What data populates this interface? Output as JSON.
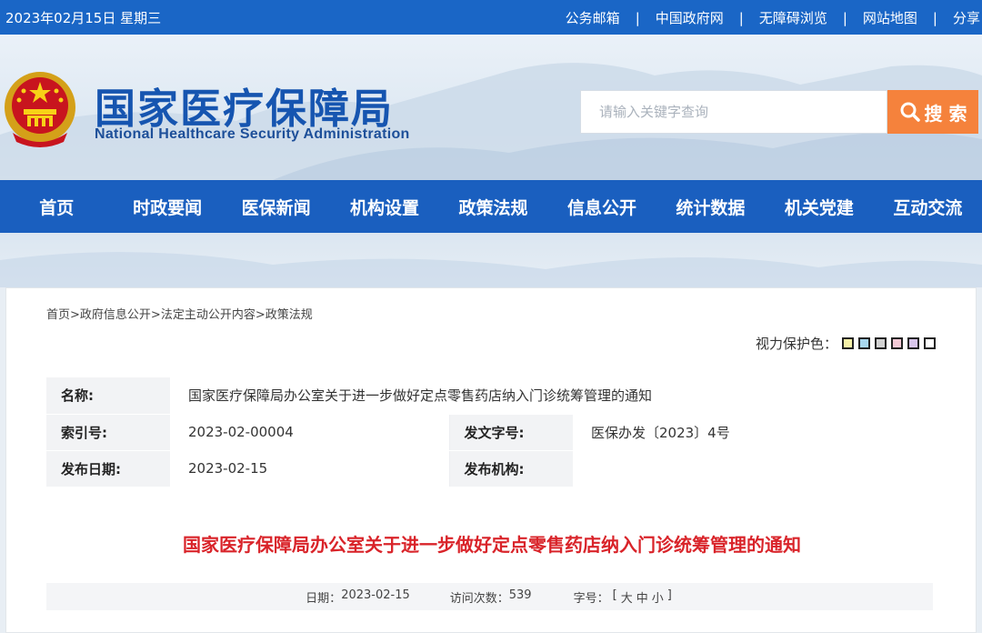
{
  "topbar": {
    "date": "2023年02月15日 星期三",
    "links": [
      "公务邮箱",
      "中国政府网",
      "无障碍浏览",
      "网站地图",
      "分享"
    ],
    "separator": "|"
  },
  "header": {
    "logo_cn": "国家医疗保障局",
    "logo_en": "National Healthcare Security Administration",
    "search_placeholder": "请输入关键字查询",
    "search_button": "搜 索"
  },
  "nav": [
    "首页",
    "时政要闻",
    "医保新闻",
    "机构设置",
    "政策法规",
    "信息公开",
    "统计数据",
    "机关党建",
    "互动交流"
  ],
  "breadcrumb": [
    "首页>",
    "政府信息公开>",
    "法定主动公开内容>",
    "政策法规"
  ],
  "vision": {
    "label": "视力保护色：",
    "colors": [
      "#f6f1a8",
      "#a8d8ef",
      "#d2d2d2",
      "#f3c9d6",
      "#d9c6ec",
      "#ffffff"
    ]
  },
  "meta": {
    "name_label": "名称:",
    "name_value": "国家医疗保障局办公室关于进一步做好定点零售药店纳入门诊统筹管理的通知",
    "index_label": "索引号:",
    "index_value": "2023-02-00004",
    "docno_label": "发文字号:",
    "docno_value": "医保办发〔2023〕4号",
    "date_label": "发布日期:",
    "date_value": "2023-02-15",
    "org_label": "发布机构:",
    "org_value": ""
  },
  "article": {
    "title": "国家医疗保障局办公室关于进一步做好定点零售药店纳入门诊统筹管理的通知",
    "date_label": "日期：",
    "date_value": "2023-02-15",
    "visits_label": "访问次数：",
    "visits_value": "539",
    "fontsize_label": "字号：",
    "fontsize_open": "[",
    "size_large": "大",
    "size_medium": "中",
    "size_small": "小",
    "fontsize_close": "]"
  }
}
